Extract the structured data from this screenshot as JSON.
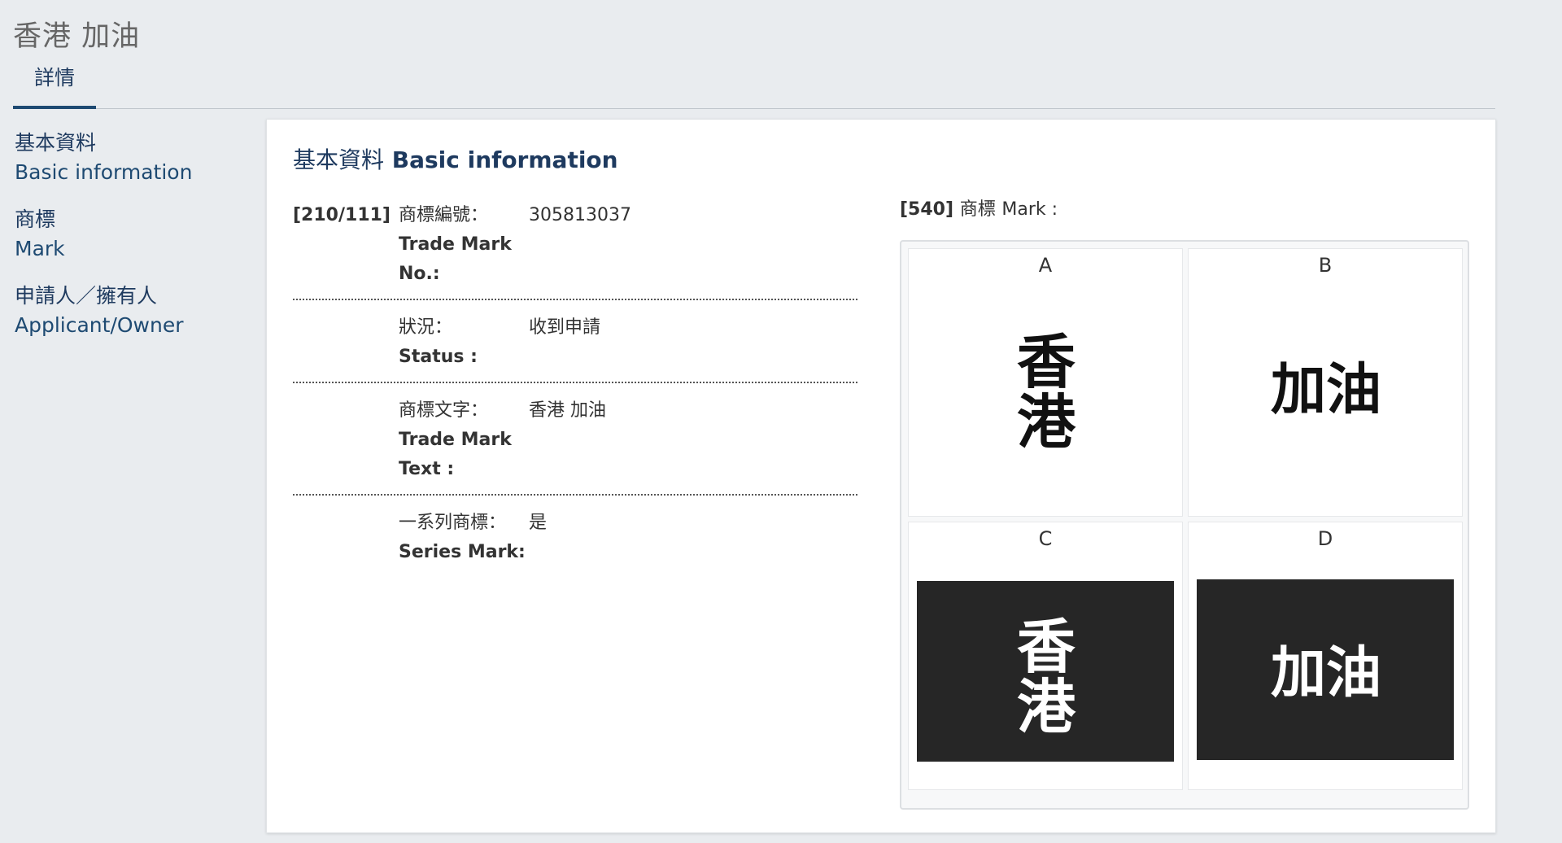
{
  "page": {
    "title": "香港 加油"
  },
  "tabs": [
    {
      "label": "詳情"
    }
  ],
  "sidebar": {
    "items": [
      {
        "zh": "基本資料",
        "en": "Basic information"
      },
      {
        "zh": "商標",
        "en": "Mark"
      },
      {
        "zh": "申請人／擁有人",
        "en": "Applicant/Owner"
      }
    ]
  },
  "card": {
    "title_zh": "基本資料",
    "title_en": "Basic information",
    "rows": [
      {
        "code": "[210/111]",
        "label_zh": "商標編號：",
        "label_en": "Trade Mark No.:",
        "value": "305813037"
      },
      {
        "code": "",
        "label_zh": "狀況：",
        "label_en": "Status :",
        "value": "收到申請"
      },
      {
        "code": "",
        "label_zh": "商標文字：",
        "label_en": "Trade Mark Text :",
        "value": "香港 加油"
      },
      {
        "code": "",
        "label_zh": "一系列商標：",
        "label_en": "Series Mark:",
        "value": "是"
      }
    ],
    "mark_label_code": "[540]",
    "mark_label_zh": "商標",
    "mark_label_en": "Mark :",
    "marks": [
      {
        "letter": "A",
        "text_top": "香",
        "text_bottom": "港",
        "text_line": "",
        "theme": "light"
      },
      {
        "letter": "B",
        "text_top": "",
        "text_bottom": "",
        "text_line": "加油",
        "theme": "light"
      },
      {
        "letter": "C",
        "text_top": "香",
        "text_bottom": "港",
        "text_line": "",
        "theme": "dark"
      },
      {
        "letter": "D",
        "text_top": "",
        "text_bottom": "",
        "text_line": "加油",
        "theme": "dark"
      }
    ]
  },
  "colors": {
    "accent": "#1e4a72",
    "link": "#1e3a5f",
    "background": "#e9ecef",
    "mark_dark_bg": "#262626"
  }
}
